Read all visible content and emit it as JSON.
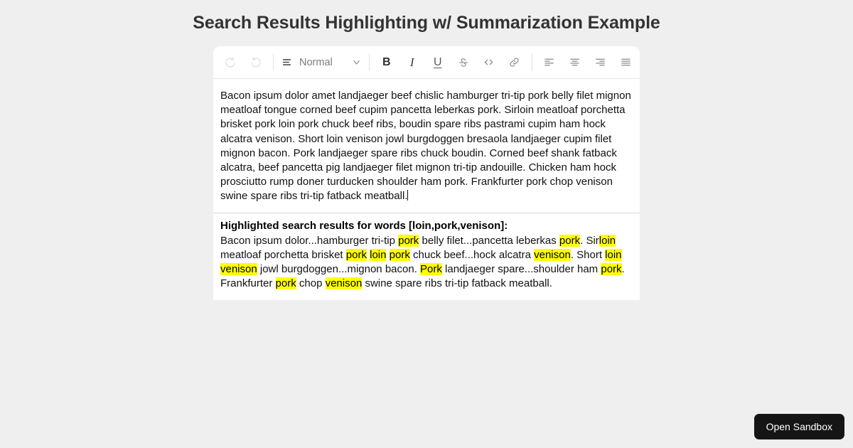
{
  "page": {
    "title": "Search Results Highlighting w/ Summarization Example",
    "background_color": "#efefef",
    "highlight_color": "#ffff00"
  },
  "toolbar": {
    "undo_label": "Undo",
    "redo_label": "Redo",
    "style_label": "Normal",
    "bold_label": "B",
    "italic_label": "I",
    "underline_label": "U",
    "strikethrough_label": "S",
    "code_label": "<>",
    "link_label": "Link",
    "align_left_label": "Align left",
    "align_center_label": "Align center",
    "align_right_label": "Align right",
    "align_justify_label": "Justify"
  },
  "editor": {
    "content": "Bacon ipsum dolor amet landjaeger beef chislic hamburger tri-tip pork belly filet mignon meatloaf tongue corned beef cupim pancetta leberkas pork. Sirloin meatloaf porchetta brisket pork loin pork chuck beef ribs, boudin spare ribs pastrami cupim ham hock alcatra venison. Short loin venison jowl burgdoggen bresaola landjaeger cupim filet mignon bacon. Pork landjaeger spare ribs chuck boudin. Corned beef shank fatback alcatra, beef pancetta pig landjaeger filet mignon tri-tip andouille. Chicken ham hock prosciutto rump doner turducken shoulder ham pork. Frankfurter pork chop venison swine spare ribs tri-tip fatback meatball."
  },
  "results": {
    "heading": "Highlighted search results for words [loin,pork,venison]:",
    "search_words": [
      "loin",
      "pork",
      "venison"
    ],
    "segments": [
      {
        "text": "Bacon ipsum dolor...hamburger tri-tip ",
        "highlight": false
      },
      {
        "text": "pork",
        "highlight": true
      },
      {
        "text": " belly filet...pancetta leberkas ",
        "highlight": false
      },
      {
        "text": "pork",
        "highlight": true
      },
      {
        "text": ". Sir",
        "highlight": false
      },
      {
        "text": "loin",
        "highlight": true
      },
      {
        "text": " meatloaf porchetta brisket ",
        "highlight": false
      },
      {
        "text": "pork",
        "highlight": true
      },
      {
        "text": " ",
        "highlight": false
      },
      {
        "text": "loin",
        "highlight": true
      },
      {
        "text": " ",
        "highlight": false
      },
      {
        "text": "pork",
        "highlight": true
      },
      {
        "text": " chuck beef...hock alcatra ",
        "highlight": false
      },
      {
        "text": "venison",
        "highlight": true
      },
      {
        "text": ". Short ",
        "highlight": false
      },
      {
        "text": "loin",
        "highlight": true
      },
      {
        "text": " ",
        "highlight": false
      },
      {
        "text": "venison",
        "highlight": true
      },
      {
        "text": " jowl burgdoggen...mignon bacon. ",
        "highlight": false
      },
      {
        "text": "Pork",
        "highlight": true
      },
      {
        "text": " landjaeger spare...shoulder ham ",
        "highlight": false
      },
      {
        "text": "pork",
        "highlight": true
      },
      {
        "text": ". Frankfurter ",
        "highlight": false
      },
      {
        "text": "pork",
        "highlight": true
      },
      {
        "text": " chop ",
        "highlight": false
      },
      {
        "text": "venison",
        "highlight": true
      },
      {
        "text": " swine spare ribs tri-tip fatback meatball.",
        "highlight": false
      }
    ]
  },
  "sandbox": {
    "label": "Open Sandbox"
  }
}
